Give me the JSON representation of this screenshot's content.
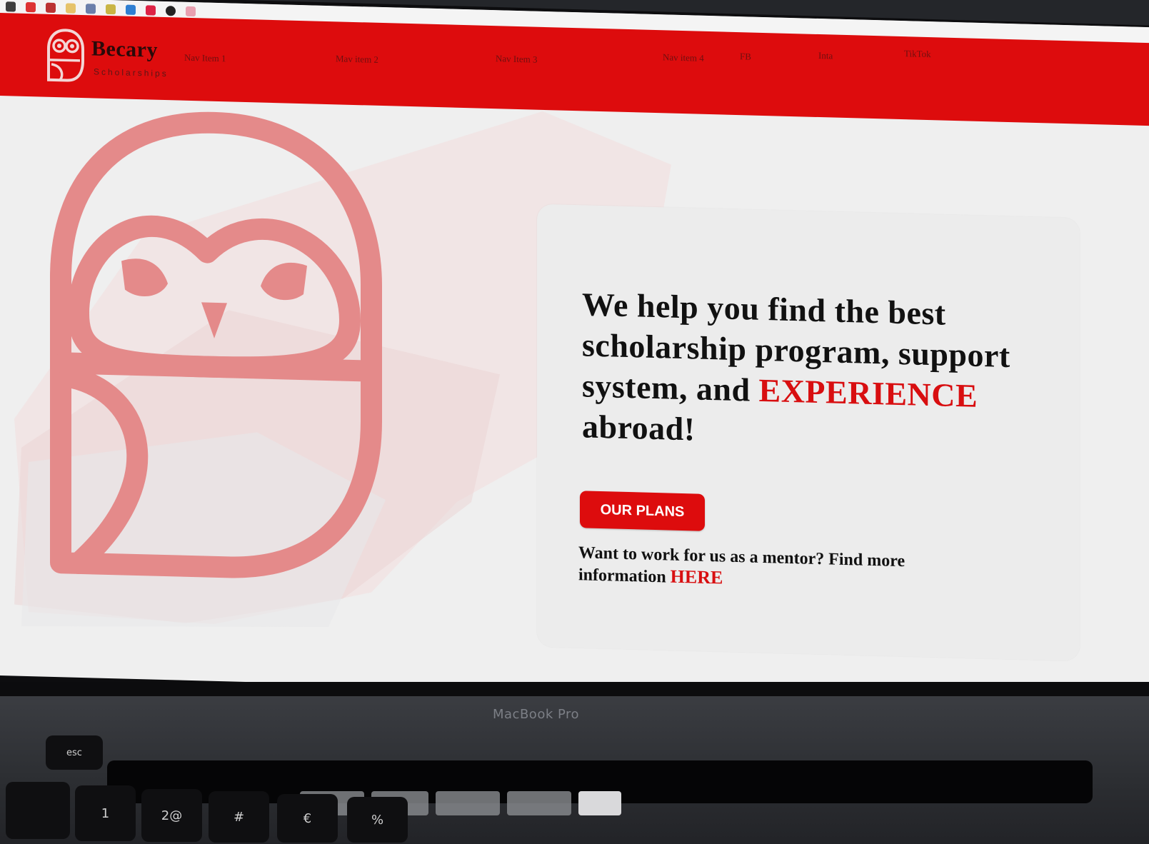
{
  "brand": {
    "name": "Becary",
    "tagline": "Scholarships"
  },
  "nav": {
    "items": [
      "Nav Item 1",
      "Mav item 2",
      "Nav Item 3",
      "Nav item 4"
    ],
    "social": [
      "FB",
      "Inta",
      "TikTok"
    ]
  },
  "hero": {
    "headline_part1": "We help you find the best scholarship program, support system, and",
    "headline_accent": "EXPERIENCE",
    "headline_part2": "abroad!",
    "cta_label": "OUR PLANS",
    "mentor_text": "Want to work for us as a mentor? Find more information",
    "mentor_link": "HERE"
  },
  "device": {
    "label": "MacBook Pro"
  },
  "keyboard": {
    "esc": "esc",
    "keys": [
      "1",
      "2@",
      "#",
      "€",
      "%"
    ]
  },
  "colors": {
    "brand_red": "#dd0c0d",
    "owl_pink": "#e58a8a",
    "page_bg": "#efefef",
    "text": "#111111"
  }
}
